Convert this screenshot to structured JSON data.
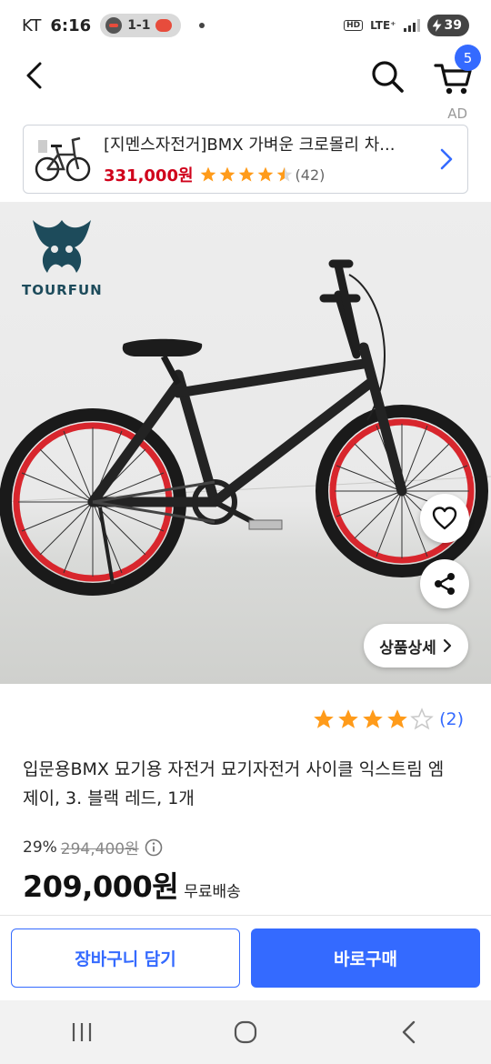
{
  "status_bar": {
    "carrier": "KT",
    "time": "6:16",
    "score": "1-1",
    "hd": "HD",
    "network": "LTE⁺",
    "battery": "39"
  },
  "nav": {
    "back_icon": "back-arrow-icon",
    "search_icon": "search-icon",
    "cart_icon": "cart-icon",
    "cart_count": "5"
  },
  "ad": {
    "label": "AD",
    "title": "[지멘스자전거]BMX 가벼운 크로몰리 차...",
    "price": "331,000원",
    "rating_stars": 4.5,
    "review_count": "(42)"
  },
  "product_image": {
    "brand": "TOURFUN",
    "wishlist_icon": "heart-icon",
    "share_icon": "share-icon",
    "detail_button": "상품상세"
  },
  "product": {
    "rating_stars": 4,
    "review_count": "(2)",
    "title": "입문용BMX 묘기용 자전거 묘기자전거 사이클 익스트림 엠제이, 3. 블랙 레드, 1개",
    "discount_rate": "29%",
    "original_price": "294,400원",
    "sale_price": "209,000원",
    "shipping": "무료배송"
  },
  "actions": {
    "add_to_cart": "장바구니 담기",
    "buy_now": "바로구매"
  },
  "system_nav": {
    "recents_icon": "recents-icon",
    "home_icon": "home-icon",
    "back_icon": "system-back-icon"
  },
  "colors": {
    "accent": "#346aff",
    "ad_price": "#d0021b",
    "star": "#ff9b1a"
  }
}
